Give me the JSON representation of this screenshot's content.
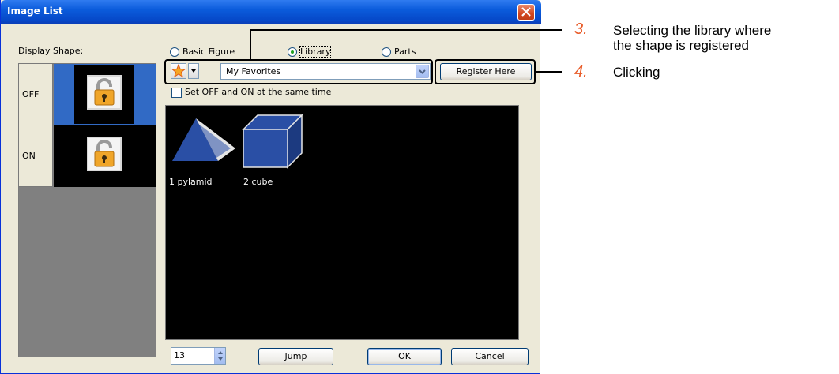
{
  "window": {
    "title": "Image List",
    "close_icon": "close-icon"
  },
  "left_pane": {
    "display_label": "Display Shape:",
    "states": [
      {
        "label": "OFF",
        "icon": "padlock-icon",
        "selected": true
      },
      {
        "label": "ON",
        "icon": "padlock-icon",
        "selected": false
      }
    ]
  },
  "shape_source": {
    "options": [
      {
        "label": "Basic Figure",
        "selected": false
      },
      {
        "label": "Library",
        "selected": true
      },
      {
        "label": "Parts",
        "selected": false
      }
    ]
  },
  "library": {
    "favorite_icon": "star-icon",
    "selected": "My Favorites",
    "register_label": "Register Here"
  },
  "checkbox": {
    "label": "Set OFF and ON at the same time",
    "checked": false
  },
  "images": [
    {
      "label": "1 pylamid",
      "icon": "pyramid-icon"
    },
    {
      "label": "2 cube",
      "icon": "cube-icon"
    }
  ],
  "bottom": {
    "page_value": "13",
    "jump_label": "Jump",
    "ok_label": "OK",
    "cancel_label": "Cancel"
  },
  "callouts": [
    {
      "number": "3.",
      "text_line1": "Selecting the library where",
      "text_line2": "the shape is registered"
    },
    {
      "number": "4.",
      "text": "Clicking"
    }
  ],
  "colors": {
    "titlebar": "#0b5cdc",
    "dialog_bg": "#ece9d8",
    "selected_row": "#316ac5",
    "callout_number": "#e85a27",
    "shape_blue": "#2a4fa5"
  }
}
